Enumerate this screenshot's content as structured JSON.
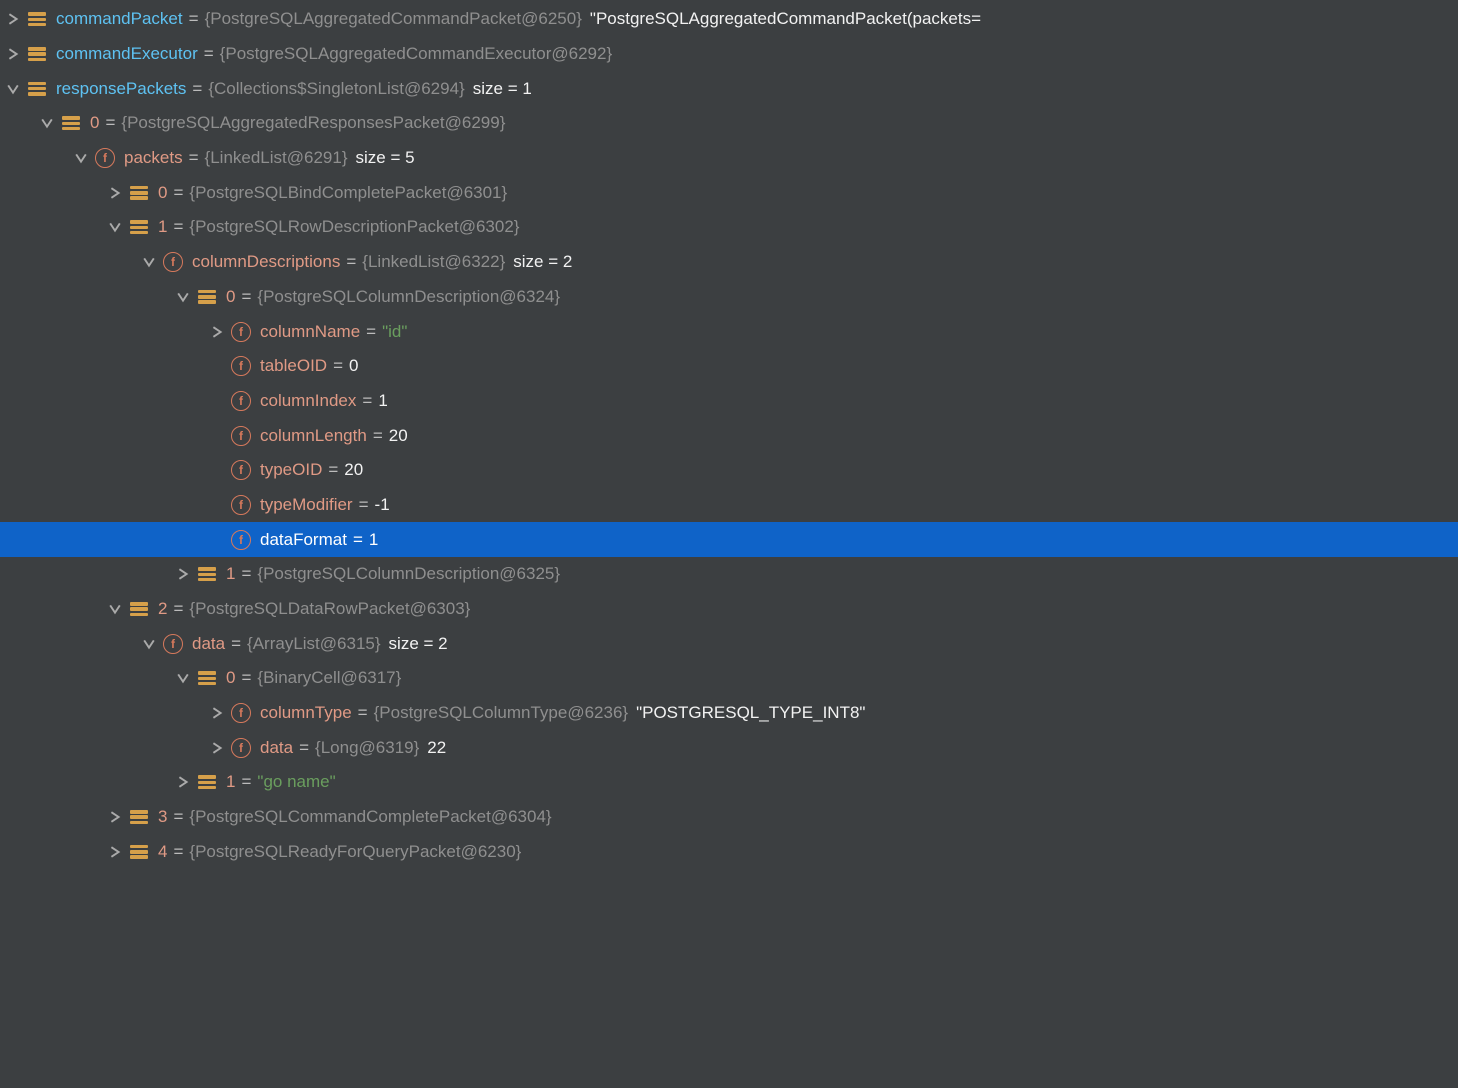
{
  "rows": [
    {
      "indent": 0,
      "arrow": "right",
      "icon": "list",
      "nameClass": "name-blue",
      "name": "commandPacket",
      "segs": [
        {
          "cls": "eq",
          "t": "="
        },
        {
          "cls": "val-dim",
          "t": "{PostgreSQLAggregatedCommandPacket@6250}"
        },
        {
          "cls": "gap",
          "t": ""
        },
        {
          "cls": "val-white",
          "t": "\"PostgreSQLAggregatedCommandPacket(packets="
        }
      ]
    },
    {
      "indent": 0,
      "arrow": "right",
      "icon": "list",
      "nameClass": "name-blue",
      "name": "commandExecutor",
      "segs": [
        {
          "cls": "eq",
          "t": "="
        },
        {
          "cls": "val-dim",
          "t": "{PostgreSQLAggregatedCommandExecutor@6292}"
        }
      ]
    },
    {
      "indent": 0,
      "arrow": "down",
      "icon": "list",
      "nameClass": "name-blue",
      "name": "responsePackets",
      "segs": [
        {
          "cls": "eq",
          "t": "="
        },
        {
          "cls": "val-dim",
          "t": "{Collections$SingletonList@6294}"
        },
        {
          "cls": "gap",
          "t": ""
        },
        {
          "cls": "val-white",
          "t": " size = 1"
        }
      ]
    },
    {
      "indent": 1,
      "arrow": "down",
      "icon": "list",
      "nameClass": "name-salmon",
      "name": "0",
      "segs": [
        {
          "cls": "eq",
          "t": "="
        },
        {
          "cls": "val-dim",
          "t": "{PostgreSQLAggregatedResponsesPacket@6299}"
        }
      ]
    },
    {
      "indent": 2,
      "arrow": "down",
      "icon": "f",
      "nameClass": "name-salmon",
      "name": "packets",
      "segs": [
        {
          "cls": "eq",
          "t": "="
        },
        {
          "cls": "val-dim",
          "t": "{LinkedList@6291}"
        },
        {
          "cls": "gap",
          "t": ""
        },
        {
          "cls": "val-white",
          "t": " size = 5"
        }
      ]
    },
    {
      "indent": 3,
      "arrow": "right",
      "icon": "list",
      "nameClass": "name-salmon",
      "name": "0",
      "segs": [
        {
          "cls": "eq",
          "t": "="
        },
        {
          "cls": "val-dim",
          "t": "{PostgreSQLBindCompletePacket@6301}"
        }
      ]
    },
    {
      "indent": 3,
      "arrow": "down",
      "icon": "list",
      "nameClass": "name-salmon",
      "name": "1",
      "segs": [
        {
          "cls": "eq",
          "t": "="
        },
        {
          "cls": "val-dim",
          "t": "{PostgreSQLRowDescriptionPacket@6302}"
        }
      ]
    },
    {
      "indent": 4,
      "arrow": "down",
      "icon": "f",
      "nameClass": "name-salmon",
      "name": "columnDescriptions",
      "segs": [
        {
          "cls": "eq",
          "t": "="
        },
        {
          "cls": "val-dim",
          "t": "{LinkedList@6322}"
        },
        {
          "cls": "gap",
          "t": ""
        },
        {
          "cls": "val-white",
          "t": " size = 2"
        }
      ]
    },
    {
      "indent": 5,
      "arrow": "down",
      "icon": "list",
      "nameClass": "name-salmon",
      "name": "0",
      "segs": [
        {
          "cls": "eq",
          "t": "="
        },
        {
          "cls": "val-dim",
          "t": "{PostgreSQLColumnDescription@6324}"
        }
      ]
    },
    {
      "indent": 6,
      "arrow": "right",
      "icon": "f",
      "nameClass": "name-salmon",
      "name": "columnName",
      "segs": [
        {
          "cls": "eq",
          "t": "="
        },
        {
          "cls": "val-green",
          "t": "\"id\""
        }
      ]
    },
    {
      "indent": 6,
      "arrow": "none",
      "icon": "f",
      "nameClass": "name-salmon",
      "name": "tableOID",
      "segs": [
        {
          "cls": "eq",
          "t": "="
        },
        {
          "cls": "val-white",
          "t": "0"
        }
      ]
    },
    {
      "indent": 6,
      "arrow": "none",
      "icon": "f",
      "nameClass": "name-salmon",
      "name": "columnIndex",
      "segs": [
        {
          "cls": "eq",
          "t": "="
        },
        {
          "cls": "val-white",
          "t": "1"
        }
      ]
    },
    {
      "indent": 6,
      "arrow": "none",
      "icon": "f",
      "nameClass": "name-salmon",
      "name": "columnLength",
      "segs": [
        {
          "cls": "eq",
          "t": "="
        },
        {
          "cls": "val-white",
          "t": "20"
        }
      ]
    },
    {
      "indent": 6,
      "arrow": "none",
      "icon": "f",
      "nameClass": "name-salmon",
      "name": "typeOID",
      "segs": [
        {
          "cls": "eq",
          "t": "="
        },
        {
          "cls": "val-white",
          "t": "20"
        }
      ]
    },
    {
      "indent": 6,
      "arrow": "none",
      "icon": "f",
      "nameClass": "name-salmon",
      "name": "typeModifier",
      "segs": [
        {
          "cls": "eq",
          "t": "="
        },
        {
          "cls": "val-white",
          "t": "-1"
        }
      ]
    },
    {
      "indent": 6,
      "arrow": "none",
      "icon": "f",
      "nameClass": "name-salmon",
      "selected": true,
      "name": "dataFormat",
      "segs": [
        {
          "cls": "eq",
          "t": "="
        },
        {
          "cls": "val-white",
          "t": "1"
        }
      ]
    },
    {
      "indent": 5,
      "arrow": "right",
      "icon": "list",
      "nameClass": "name-salmon",
      "name": "1",
      "segs": [
        {
          "cls": "eq",
          "t": "="
        },
        {
          "cls": "val-dim",
          "t": "{PostgreSQLColumnDescription@6325}"
        }
      ]
    },
    {
      "indent": 3,
      "arrow": "down",
      "icon": "list",
      "nameClass": "name-salmon",
      "name": "2",
      "segs": [
        {
          "cls": "eq",
          "t": "="
        },
        {
          "cls": "val-dim",
          "t": "{PostgreSQLDataRowPacket@6303}"
        }
      ]
    },
    {
      "indent": 4,
      "arrow": "down",
      "icon": "f",
      "nameClass": "name-salmon",
      "name": "data",
      "segs": [
        {
          "cls": "eq",
          "t": "="
        },
        {
          "cls": "val-dim",
          "t": "{ArrayList@6315}"
        },
        {
          "cls": "gap",
          "t": ""
        },
        {
          "cls": "val-white",
          "t": " size = 2"
        }
      ]
    },
    {
      "indent": 5,
      "arrow": "down",
      "icon": "list",
      "nameClass": "name-salmon",
      "name": "0",
      "segs": [
        {
          "cls": "eq",
          "t": "="
        },
        {
          "cls": "val-dim",
          "t": "{BinaryCell@6317}"
        }
      ]
    },
    {
      "indent": 6,
      "arrow": "right",
      "icon": "f",
      "nameClass": "name-salmon",
      "name": "columnType",
      "segs": [
        {
          "cls": "eq",
          "t": "="
        },
        {
          "cls": "val-dim",
          "t": "{PostgreSQLColumnType@6236}"
        },
        {
          "cls": "gap",
          "t": ""
        },
        {
          "cls": "val-white",
          "t": "\"POSTGRESQL_TYPE_INT8\""
        }
      ]
    },
    {
      "indent": 6,
      "arrow": "right",
      "icon": "f",
      "nameClass": "name-salmon",
      "name": "data",
      "segs": [
        {
          "cls": "eq",
          "t": "="
        },
        {
          "cls": "val-dim",
          "t": "{Long@6319}"
        },
        {
          "cls": "gap",
          "t": ""
        },
        {
          "cls": "val-white",
          "t": "22"
        }
      ]
    },
    {
      "indent": 5,
      "arrow": "right",
      "icon": "list",
      "nameClass": "name-salmon",
      "name": "1",
      "segs": [
        {
          "cls": "eq",
          "t": "="
        },
        {
          "cls": "val-green",
          "t": "\"go name\""
        }
      ]
    },
    {
      "indent": 3,
      "arrow": "right",
      "icon": "list",
      "nameClass": "name-salmon",
      "name": "3",
      "segs": [
        {
          "cls": "eq",
          "t": "="
        },
        {
          "cls": "val-dim",
          "t": "{PostgreSQLCommandCompletePacket@6304}"
        }
      ]
    },
    {
      "indent": 3,
      "arrow": "right",
      "icon": "list",
      "nameClass": "name-salmon",
      "name": "4",
      "segs": [
        {
          "cls": "eq",
          "t": "="
        },
        {
          "cls": "val-dim",
          "t": "{PostgreSQLReadyForQueryPacket@6230}"
        }
      ]
    }
  ]
}
